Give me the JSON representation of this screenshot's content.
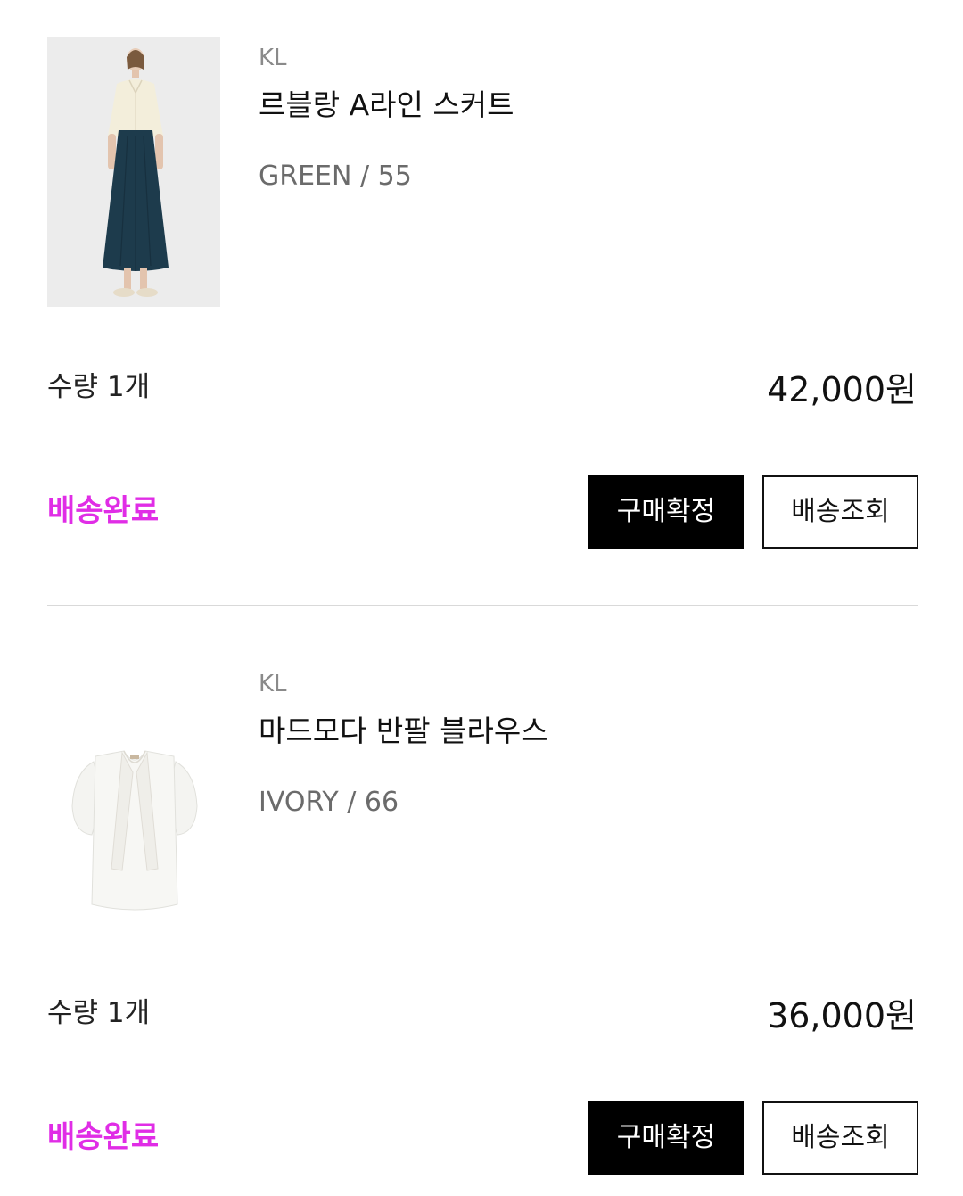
{
  "orders": [
    {
      "brand": "KL",
      "name": "르블랑 A라인 스커트",
      "option": "GREEN / 55",
      "quantity": "수량 1개",
      "price": "42,000원",
      "status": "배송완료",
      "confirm_label": "구매확정",
      "track_label": "배송조회"
    },
    {
      "brand": "KL",
      "name": "마드모다 반팔 블라우스",
      "option": "IVORY / 66",
      "quantity": "수량 1개",
      "price": "36,000원",
      "status": "배송완료",
      "confirm_label": "구매확정",
      "track_label": "배송조회"
    }
  ],
  "colors": {
    "status": "#e02de6",
    "confirm_bg": "#000000",
    "divider": "#d9d9d9"
  }
}
